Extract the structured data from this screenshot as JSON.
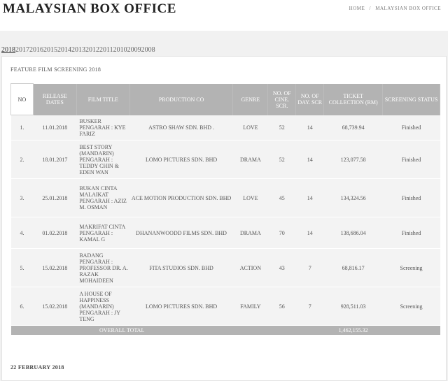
{
  "site": {
    "title": "MALAYSIAN BOX OFFICE"
  },
  "breadcrumb": {
    "home": "HOME",
    "separator": "/",
    "current": "MALAYSIAN BOX OFFICE"
  },
  "years": [
    "2018",
    "2017",
    "2016",
    "2015",
    "2014",
    "2013",
    "2012",
    "2011",
    "2010",
    "2009",
    "2008"
  ],
  "section_title": "FEATURE FILM SCREENING 2018",
  "table": {
    "headers": {
      "no": "NO",
      "release": "RELEASE DATES",
      "film": "FILM TITLE",
      "production": "PRODUCTION CO",
      "genre": "GENRE",
      "cine": "NO. OF CINE. SCR.",
      "days": "NO. OF DAY. SCR",
      "collection": "TICKET COLLECTION (RM)",
      "status": "SCREENING STATUS"
    },
    "rows": [
      {
        "no": "1.",
        "release": "11.01.2018",
        "film": "BUSKER PENGARAH : KYE FARIZ",
        "production": "ASTRO SHAW SDN. BHD .",
        "genre": "LOVE",
        "cine": "52",
        "days": "14",
        "collection": "68,739.94",
        "status": "Finished"
      },
      {
        "no": "2.",
        "release": "18.01.2017",
        "film": "BEST STORY (MANDARIN) PENGARAH : TEDDY CHIN & EDEN WAN",
        "production": "LOMO PICTURES SDN. BHD",
        "genre": "DRAMA",
        "cine": "52",
        "days": "14",
        "collection": "123,077.58",
        "status": "Finished"
      },
      {
        "no": "3.",
        "release": "25.01.2018",
        "film": "BUKAN CINTA MALAIKAT PENGARAH : AZIZ M. OSMAN",
        "production": "ACE MOTION PRODUCTION SDN. BHD",
        "genre": "LOVE",
        "cine": "45",
        "days": "14",
        "collection": "134,324.56",
        "status": "Finished"
      },
      {
        "no": "4.",
        "release": "01.02.2018",
        "film": "MAKRIFAT CINTA PENGARAH : KAMAL G",
        "production": "DHANANWOODD FILMS SDN. BHD",
        "genre": "DRAMA",
        "cine": "70",
        "days": "14",
        "collection": "138,686.04",
        "status": "Finished"
      },
      {
        "no": "5.",
        "release": "15.02.2018",
        "film": "BADANG PENGARAH : PROFESSOR DR. A. RAZAK MOHAIDEEN",
        "production": "FITA STUDIOS SDN. BHD",
        "genre": "ACTION",
        "cine": "43",
        "days": "7",
        "collection": "68,816.17",
        "status": "Screening"
      },
      {
        "no": "6.",
        "release": "15.02.2018",
        "film": "A HOUSE OF HAPPINESS (MANDARIN) PENGARAH : JY TENG",
        "production": "LOMO PICTURES SDN. BHD",
        "genre": "FAMILY",
        "cine": "56",
        "days": "7",
        "collection": "928,511.03",
        "status": "Screening"
      }
    ],
    "total_label": "OVERALL TOTAL",
    "total_value": "1,462,155.32"
  },
  "footer_date": "22 FEBRUARY 2018"
}
